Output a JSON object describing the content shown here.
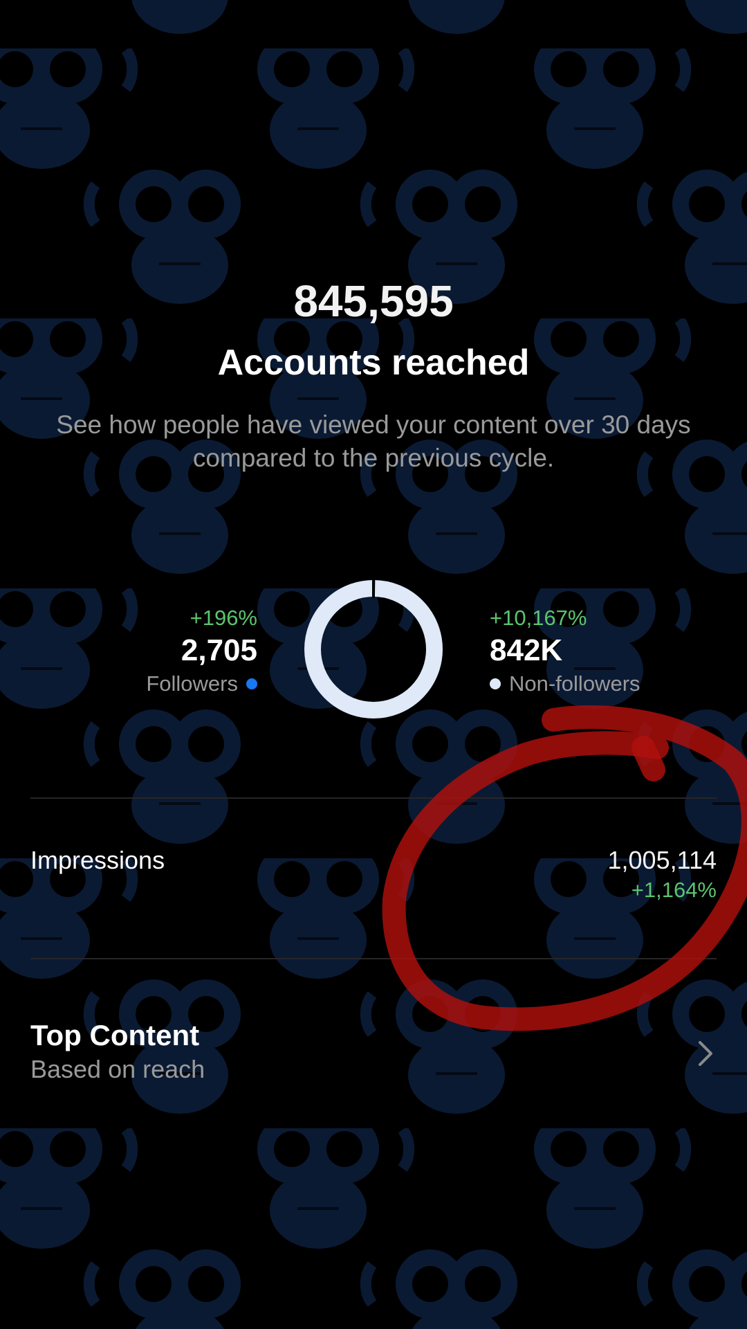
{
  "summary": {
    "accounts_reached_value": "845,595",
    "accounts_reached_label": "Accounts reached",
    "description": "See how people have viewed your content over 30 days compared to the previous cycle."
  },
  "followers": {
    "change": "+196%",
    "value": "2,705",
    "label": "Followers",
    "color": "#1877f2"
  },
  "non_followers": {
    "change": "+10,167%",
    "value": "842K",
    "label": "Non-followers",
    "color": "#dfe9f7"
  },
  "donut": {
    "followers_fraction": 0.0032,
    "non_followers_fraction": 0.9968
  },
  "impressions": {
    "label": "Impressions",
    "value": "1,005,114",
    "change": "+1,164%"
  },
  "top_content": {
    "title": "Top Content",
    "subtitle": "Based on reach",
    "icon": "chevron-right-icon"
  },
  "colors": {
    "background": "#000000",
    "positive": "#5cc46e",
    "secondary_text": "#9a9a9a",
    "pattern": "#0b1a33",
    "annotation": "#b0100c"
  }
}
